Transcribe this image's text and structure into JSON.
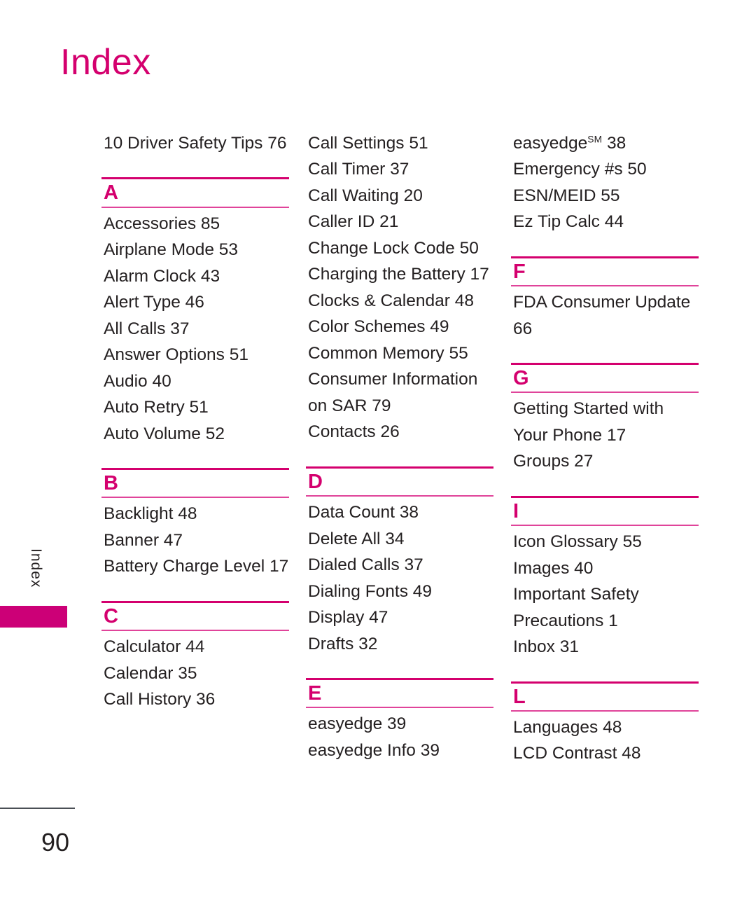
{
  "page": {
    "title": "Index",
    "number": "90",
    "side_tab_label": "Index",
    "accent_color": "#d4006e",
    "tab_block_color": "#cc0077",
    "text_color": "#231f20"
  },
  "columns": [
    {
      "groups": [
        {
          "letter": null,
          "entries": [
            {
              "text": "10 Driver Safety Tips 76"
            }
          ]
        },
        {
          "letter": "A",
          "entries": [
            {
              "text": "Accessories 85"
            },
            {
              "text": "Airplane Mode 53"
            },
            {
              "text": "Alarm Clock 43"
            },
            {
              "text": "Alert Type 46"
            },
            {
              "text": "All Calls 37"
            },
            {
              "text": "Answer Options 51"
            },
            {
              "text": "Audio 40"
            },
            {
              "text": "Auto Retry 51"
            },
            {
              "text": "Auto Volume 52"
            }
          ]
        },
        {
          "letter": "B",
          "entries": [
            {
              "text": "Backlight 48"
            },
            {
              "text": "Banner 47"
            },
            {
              "text": "Battery Charge Level 17"
            }
          ]
        },
        {
          "letter": "C",
          "entries": [
            {
              "text": "Calculator 44"
            },
            {
              "text": "Calendar 35"
            },
            {
              "text": "Call History 36"
            }
          ]
        }
      ]
    },
    {
      "groups": [
        {
          "letter": null,
          "entries": [
            {
              "text": "Call Settings 51"
            },
            {
              "text": "Call Timer 37"
            },
            {
              "text": "Call Waiting 20"
            },
            {
              "text": "Caller ID 21"
            },
            {
              "text": "Change Lock Code 50"
            },
            {
              "text": "Charging the Battery 17"
            },
            {
              "text": "Clocks & Calendar 48"
            },
            {
              "text": "Color Schemes 49"
            },
            {
              "text": "Common Memory 55"
            },
            {
              "text": "Consumer Information on SAR 79"
            },
            {
              "text": "Contacts 26"
            }
          ]
        },
        {
          "letter": "D",
          "entries": [
            {
              "text": "Data Count 38"
            },
            {
              "text": "Delete All 34"
            },
            {
              "text": "Dialed Calls 37"
            },
            {
              "text": "Dialing Fonts 49"
            },
            {
              "text": "Display 47"
            },
            {
              "text": "Drafts 32"
            }
          ]
        },
        {
          "letter": "E",
          "entries": [
            {
              "text": "easyedge 39"
            },
            {
              "text": "easyedge Info 39"
            }
          ]
        }
      ]
    },
    {
      "groups": [
        {
          "letter": null,
          "entries": [
            {
              "text": "easyedge",
              "sup": "SM",
              "after": " 38"
            },
            {
              "text": "Emergency #s 50"
            },
            {
              "text": "ESN/MEID 55"
            },
            {
              "text": "Ez Tip Calc 44"
            }
          ]
        },
        {
          "letter": "F",
          "entries": [
            {
              "text": "FDA Consumer Update 66"
            }
          ]
        },
        {
          "letter": "G",
          "entries": [
            {
              "text": "Getting Started with Your Phone 17"
            },
            {
              "text": "Groups 27"
            }
          ]
        },
        {
          "letter": "I",
          "entries": [
            {
              "text": "Icon Glossary 55"
            },
            {
              "text": "Images 40"
            },
            {
              "text": "Important Safety Precautions 1"
            },
            {
              "text": "Inbox 31"
            }
          ]
        },
        {
          "letter": "L",
          "entries": [
            {
              "text": "Languages 48"
            },
            {
              "text": "LCD Contrast 48"
            }
          ]
        }
      ]
    }
  ]
}
